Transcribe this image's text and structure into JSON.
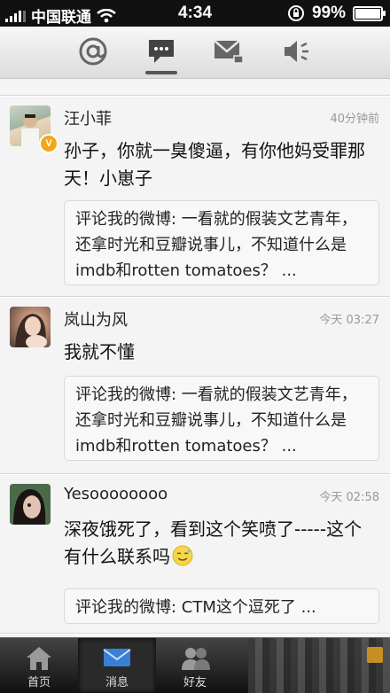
{
  "status_bar": {
    "carrier": "中国联通",
    "time": "4:34",
    "battery_percent": "99%",
    "battery_level": 0.99
  },
  "top_tabs": [
    {
      "name": "mentions",
      "icon": "at-icon"
    },
    {
      "name": "comments",
      "icon": "comment-bubble-icon",
      "active": true
    },
    {
      "name": "messages",
      "icon": "envelope-icon"
    },
    {
      "name": "notifications",
      "icon": "speaker-icon"
    }
  ],
  "feed": [
    {
      "name": "汪小菲",
      "time": "40分钟前",
      "verified_badge": "V",
      "content": "孙子，你就一臭傻逼，有你他妈受罪那天！小崽子",
      "quote": "评论我的微博: 一看就的假装文艺青年，还拿时光和豆瓣说事儿，不知道什么是imdb和rotten tomatoes？ ..."
    },
    {
      "name": "岚山为风",
      "time": "今天 03:27",
      "content": "我就不懂",
      "quote": "评论我的微博: 一看就的假装文艺青年，还拿时光和豆瓣说事儿，不知道什么是imdb和rotten tomatoes？ ..."
    },
    {
      "name": "Yesoooooooo",
      "time": "今天 02:58",
      "content": "深夜饿死了，看到这个笑喷了-----这个有什么联系吗",
      "emoji": "sweat-smile-emoji",
      "quote": "评论我的微博: CTM这个逗死了 ..."
    }
  ],
  "bottom_tabs": [
    {
      "label": "首页",
      "icon": "home-icon"
    },
    {
      "label": "消息",
      "icon": "envelope-icon",
      "active": true
    },
    {
      "label": "好友",
      "icon": "friends-icon"
    }
  ],
  "colors": {
    "accent_blue": "#3a7fd6",
    "badge_orange": "#f0a818"
  }
}
